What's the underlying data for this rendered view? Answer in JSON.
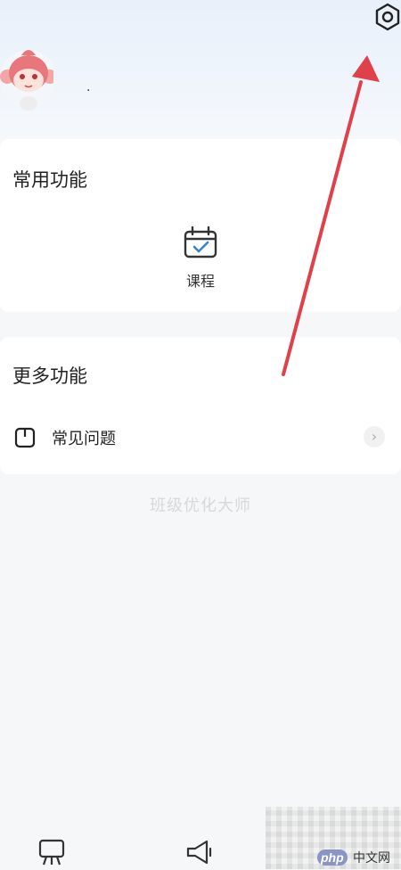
{
  "profile": {
    "name": "."
  },
  "common": {
    "title": "常用功能",
    "items": [
      {
        "label": "课程",
        "icon": "calendar-check-icon"
      }
    ]
  },
  "more": {
    "title": "更多功能",
    "items": [
      {
        "label": "常见问题",
        "icon": "document-icon"
      }
    ]
  },
  "footer": {
    "text": "班级优化大师"
  },
  "tabbar": {
    "icons": [
      "classroom-icon",
      "megaphone-icon"
    ]
  },
  "watermark": {
    "php": "php",
    "site": "中文网"
  },
  "colors": {
    "accent": "#3b82c4",
    "annotation_arrow": "#e0404a"
  }
}
